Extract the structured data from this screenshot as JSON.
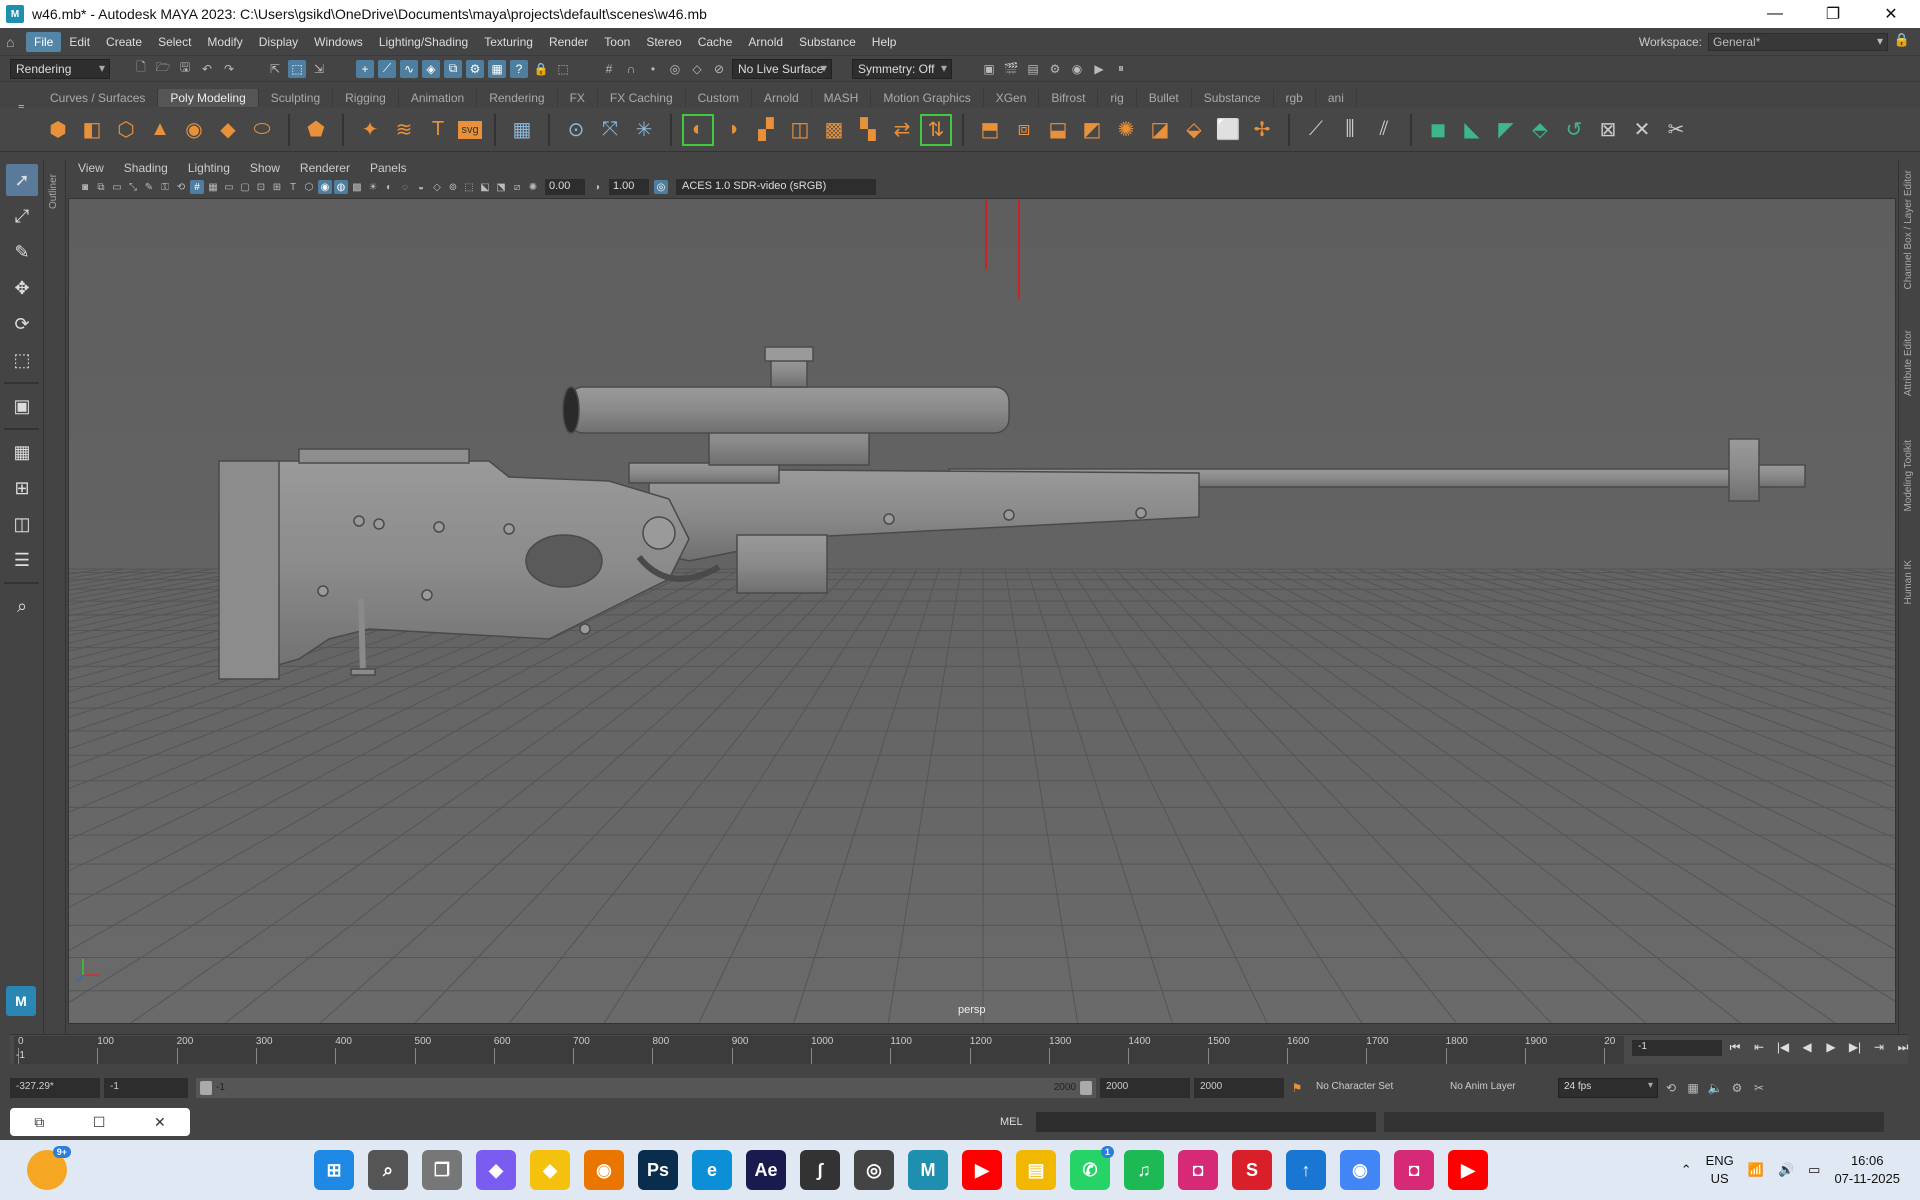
{
  "window": {
    "title": "w46.mb* - Autodesk MAYA 2023: C:\\Users\\gsikd\\OneDrive\\Documents\\maya\\projects\\default\\scenes\\w46.mb",
    "app_icon": "M"
  },
  "menus": [
    "File",
    "Edit",
    "Create",
    "Select",
    "Modify",
    "Display",
    "Windows",
    "Lighting/Shading",
    "Texturing",
    "Render",
    "Toon",
    "Stereo",
    "Cache",
    "Arnold",
    "Substance",
    "Help"
  ],
  "workspace": {
    "label": "Workspace:",
    "value": "General*"
  },
  "status_line": {
    "menu_set": "Rendering",
    "live_surface": "No Live Surface",
    "symmetry": "Symmetry: Off"
  },
  "shelf_tabs": [
    "Curves / Surfaces",
    "Poly Modeling",
    "Sculpting",
    "Rigging",
    "Animation",
    "Rendering",
    "FX",
    "FX Caching",
    "Custom",
    "Arnold",
    "MASH",
    "Motion Graphics",
    "XGen",
    "Bifrost",
    "rig",
    "Bullet",
    "Substance",
    "rgb",
    "ani"
  ],
  "active_shelf": "Poly Modeling",
  "viewport_menu": [
    "View",
    "Shading",
    "Lighting",
    "Show",
    "Renderer",
    "Panels"
  ],
  "panel_toolbar": {
    "exposure": "0.00",
    "gamma": "1.00",
    "color_space": "ACES 1.0 SDR-video (sRGB)"
  },
  "camera_label": "persp",
  "side_tabs": {
    "left": "Outliner",
    "right": [
      "Channel Box / Layer Editor",
      "Attribute Editor",
      "Modeling Toolkit",
      "Human IK"
    ]
  },
  "timeline": {
    "ticks": [
      "0",
      "100",
      "200",
      "300",
      "400",
      "500",
      "600",
      "700",
      "800",
      "900",
      "1000",
      "1100",
      "1200",
      "1300",
      "1400",
      "1500",
      "1600",
      "1700",
      "1800",
      "1900",
      "20"
    ],
    "current_frame_marker": "-1",
    "current_frame": "-1"
  },
  "range": {
    "field1": "-327.29*",
    "field2": "-1",
    "slider_start": "-1",
    "slider_end": "2000",
    "end1": "2000",
    "end2": "2000",
    "char_set": "No Character Set",
    "anim_layer": "No Anim Layer",
    "fps": "24 fps"
  },
  "command_line": {
    "lang": "MEL"
  },
  "taskbar": {
    "apps": [
      {
        "name": "weather",
        "label": "",
        "color": "#f5a623",
        "badge": "9+"
      },
      {
        "name": "start",
        "label": "⊞",
        "color": "#1e88e5",
        "badge": ""
      },
      {
        "name": "search",
        "label": "⌕",
        "color": "#555",
        "badge": ""
      },
      {
        "name": "task-view",
        "label": "❐",
        "color": "#777",
        "badge": ""
      },
      {
        "name": "copilot",
        "label": "◆",
        "color": "#7b5cf0",
        "badge": ""
      },
      {
        "name": "sticky",
        "label": "◆",
        "color": "#f4c20d",
        "badge": ""
      },
      {
        "name": "blender",
        "label": "◉",
        "color": "#ea7600",
        "badge": ""
      },
      {
        "name": "photoshop",
        "label": "Ps",
        "color": "#0a2d4d",
        "badge": ""
      },
      {
        "name": "edge",
        "label": "e",
        "color": "#0c8fd6",
        "badge": ""
      },
      {
        "name": "after-effects",
        "label": "Ae",
        "color": "#1b1a4e",
        "badge": ""
      },
      {
        "name": "inkscape",
        "label": "∫",
        "color": "#333",
        "badge": ""
      },
      {
        "name": "obs",
        "label": "◎",
        "color": "#444",
        "badge": ""
      },
      {
        "name": "maya",
        "label": "M",
        "color": "#1f8fb0",
        "badge": ""
      },
      {
        "name": "youtube",
        "label": "▶",
        "color": "#ff0000",
        "badge": ""
      },
      {
        "name": "file-explorer",
        "label": "▤",
        "color": "#f2b700",
        "badge": ""
      },
      {
        "name": "whatsapp",
        "label": "✆",
        "color": "#25d366",
        "badge": "1"
      },
      {
        "name": "spotify",
        "label": "♫",
        "color": "#1db954",
        "badge": ""
      },
      {
        "name": "instagram",
        "label": "◘",
        "color": "#d62976",
        "badge": ""
      },
      {
        "name": "substance",
        "label": "S",
        "color": "#d9202a",
        "badge": ""
      },
      {
        "name": "app-blue",
        "label": "↑",
        "color": "#1976d2",
        "badge": ""
      },
      {
        "name": "chrome",
        "label": "◉",
        "color": "#4285f4",
        "badge": ""
      },
      {
        "name": "instagram-2",
        "label": "◘",
        "color": "#d62976",
        "badge": ""
      },
      {
        "name": "youtube-2",
        "label": "▶",
        "color": "#ff0000",
        "badge": ""
      }
    ],
    "lang_top": "ENG",
    "lang_bottom": "US",
    "time": "16:06",
    "date": "07-11-2025"
  }
}
